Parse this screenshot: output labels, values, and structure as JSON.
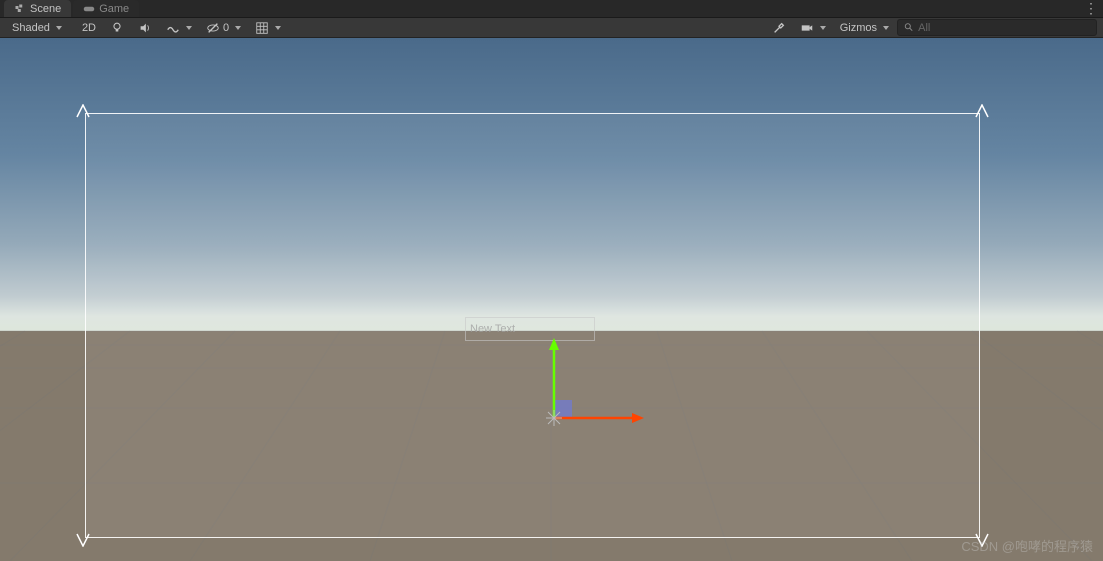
{
  "tabs": {
    "scene": "Scene",
    "game": "Game"
  },
  "toolbar": {
    "shading_mode": "Shaded",
    "view_mode": "2D",
    "hidden_count": "0",
    "gizmos_label": "Gizmos"
  },
  "search": {
    "placeholder": "All"
  },
  "scene": {
    "text_label": "New Text"
  },
  "watermark": "CSDN @咆哮的程序猿"
}
